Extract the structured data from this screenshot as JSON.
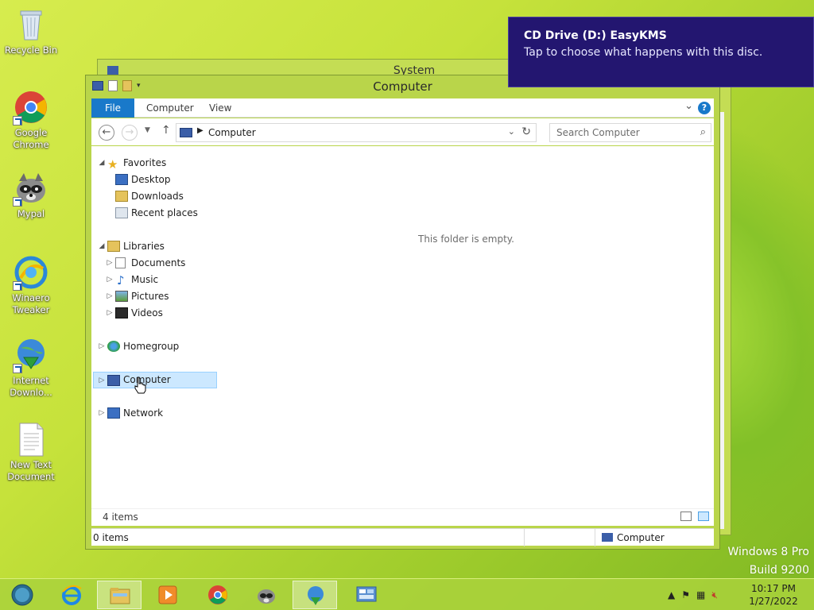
{
  "desktop": {
    "icons": [
      {
        "label": "Recycle Bin"
      },
      {
        "label": "Google Chrome"
      },
      {
        "label": "Mypal"
      },
      {
        "label": "Winaero Tweaker"
      },
      {
        "label": "Internet Downlo..."
      },
      {
        "label": "New Text Document"
      }
    ],
    "watermark": {
      "line1": "Windows 8 Pro",
      "line2": "Build 9200"
    }
  },
  "background_window": {
    "title": "System"
  },
  "explorer": {
    "title": "Computer",
    "ribbon_tabs": [
      "File",
      "Computer",
      "View"
    ],
    "help_label": "?",
    "address": {
      "path": "Computer"
    },
    "search": {
      "placeholder": "Search Computer"
    },
    "empty_message": "This folder is empty.",
    "nav": {
      "favorites": {
        "label": "Favorites",
        "items": [
          "Desktop",
          "Downloads",
          "Recent places"
        ]
      },
      "libraries": {
        "label": "Libraries",
        "items": [
          "Documents",
          "Music",
          "Pictures",
          "Videos"
        ]
      },
      "homegroup": "Homegroup",
      "computer": "Computer",
      "network": "Network"
    },
    "status": {
      "item_count": "4 items",
      "selected_count": "0 items",
      "location": "Computer"
    }
  },
  "toast": {
    "title": "CD Drive (D:) EasyKMS",
    "message": "Tap to choose what happens with this disc."
  },
  "taskbar": {
    "clock_time": "10:17 PM",
    "clock_date": "1/27/2022"
  },
  "colors": {
    "accent": "#1979ca",
    "toast_bg": "#231670",
    "selection": "#cce8ff"
  }
}
